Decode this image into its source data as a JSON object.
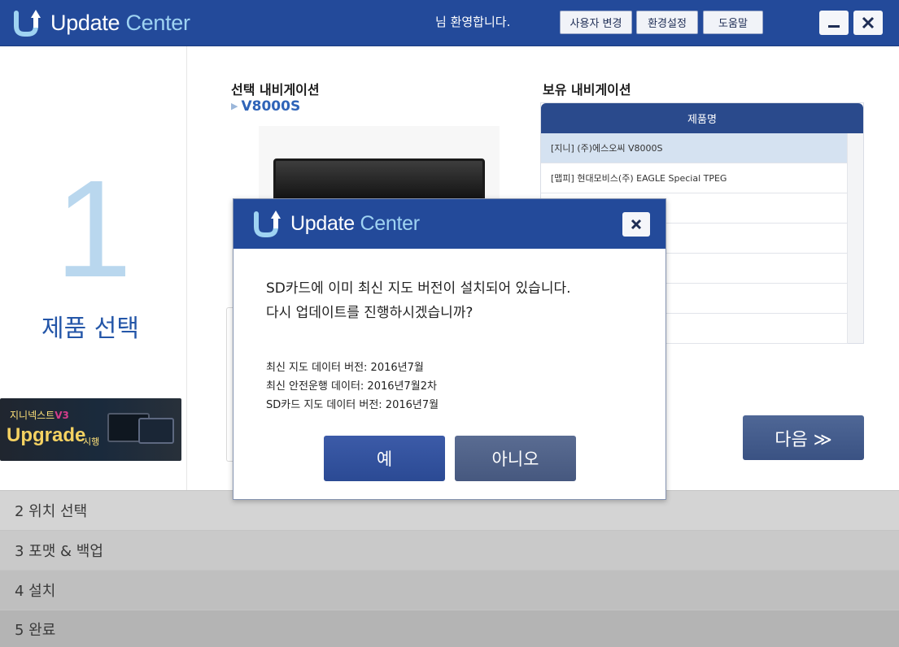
{
  "app": {
    "title_part1": "Update",
    "title_part2": "Center",
    "welcome": "님 환영합니다.",
    "btn_user_change": "사용자 변경",
    "btn_settings": "환경설정",
    "btn_help": "도움말",
    "icons": {
      "logo": "update-center-logo-icon",
      "minimize": "minimize-icon",
      "close": "close-icon"
    },
    "colors": {
      "header": "#234a9a",
      "accent_text": "#9fd3f2",
      "step_number": "#b9d7ee",
      "step_title": "#2456a8"
    }
  },
  "left": {
    "step_number": "1",
    "step_title": "제품 선택",
    "banner": {
      "line1_text": "지니넥스트",
      "line1_version": "V3",
      "line2": "Upgrade",
      "line2_suffix": "시행"
    }
  },
  "main": {
    "selected_label": "선택 내비게이션",
    "selected_value": "V8000S",
    "owned_label": "보유 내비게이션",
    "table_header": "제품명",
    "rows": [
      "[지니] (주)에스오씨 V8000S",
      "[맵피] 현대모비스(주) EAGLE Special TPEG",
      "",
      "",
      "",
      "",
      ""
    ],
    "next_button": "다음 ≫"
  },
  "steps": [
    "2 위치 선택",
    "3 포맷 & 백업",
    "4 설치",
    "5 완료"
  ],
  "dialog": {
    "title_part1": "Update",
    "title_part2": "Center",
    "message_line1": "SD카드에 이미 최신 지도 버전이 설치되어 있습니다.",
    "message_line2": "다시 업데이트를 진행하시겠습니까?",
    "info_line1": "최신 지도 데이터 버전: 2016년7월",
    "info_line2": "최신 안전운행 데이터: 2016년7월2차",
    "info_line3": "SD카드 지도 데이터 버전: 2016년7월",
    "yes_button": "예",
    "no_button": "아니오"
  }
}
